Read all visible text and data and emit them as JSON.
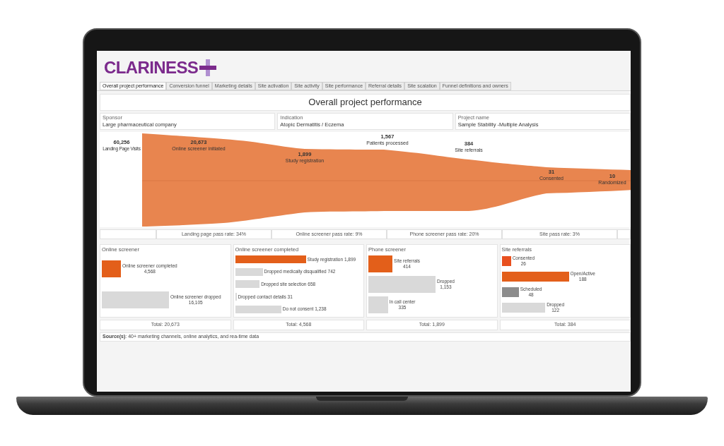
{
  "logo": {
    "text": "CLARINESS"
  },
  "tabs": [
    {
      "label": "Overall project performance",
      "selected": true
    },
    {
      "label": "Conversion funnel",
      "selected": false
    },
    {
      "label": "Marketing details",
      "selected": false
    },
    {
      "label": "Site activation",
      "selected": false
    },
    {
      "label": "Site activity",
      "selected": false
    },
    {
      "label": "Site performance",
      "selected": false
    },
    {
      "label": "Referral details",
      "selected": false
    },
    {
      "label": "Site scalation",
      "selected": false
    },
    {
      "label": "Funnel definitions and owners",
      "selected": false
    }
  ],
  "title": "Overall project performance",
  "info": [
    {
      "label": "Sponsor",
      "value": "Large pharmaceutical company"
    },
    {
      "label": "Indication",
      "value": "Atopic Dermatitis / Eczema"
    },
    {
      "label": "Project name",
      "value": "Sample Stability -Multiple Analysis"
    }
  ],
  "funnel": {
    "stages": [
      {
        "value": "60,256",
        "label": "Landing Page Visits"
      },
      {
        "value": "20,673",
        "label": "Online screener initiated"
      },
      {
        "value": "1,899",
        "label": "Study registration"
      },
      {
        "value": "1,567",
        "label": "Patients processed"
      },
      {
        "value": "384",
        "label": "Site referrals"
      },
      {
        "value": "31",
        "label": "Consented"
      },
      {
        "value": "10",
        "label": "Randomized"
      }
    ]
  },
  "pass_rates": [
    "Landing page pass rate: 34%",
    "Online screener pass rate: 9%",
    "Phone screener pass rate: 20%",
    "Site pass rate: 3%"
  ],
  "panels": [
    {
      "title": "Online screener",
      "kind": "stacked",
      "total": "Total: 20,673",
      "bars": [
        {
          "label": "Online screener completed",
          "value": "4,568",
          "color": "#e35f1a"
        },
        {
          "label": "Online screener dropped",
          "value": "16,105",
          "color": "#d9d9d9"
        }
      ]
    },
    {
      "title": "Online screener completed",
      "kind": "inline",
      "total": "Total: 4,568",
      "bars": [
        {
          "label": "Study registration",
          "value": "1,899",
          "color": "#e35f1a"
        },
        {
          "label": "Dropped medically disqualified",
          "value": "742",
          "color": "#d9d9d9"
        },
        {
          "label": "Dropped site selection",
          "value": "658",
          "color": "#d9d9d9"
        },
        {
          "label": "Dropped contact details",
          "value": "31",
          "color": "#d9d9d9"
        },
        {
          "label": "Do not consent",
          "value": "1,238",
          "color": "#d9d9d9"
        }
      ]
    },
    {
      "title": "Phone screener",
      "kind": "stacked",
      "total": "Total: 1,899",
      "bars": [
        {
          "label": "Site referrals",
          "value": "414",
          "color": "#e35f1a"
        },
        {
          "label": "Dropped",
          "value": "1,153",
          "color": "#d9d9d9"
        },
        {
          "label": "In call center",
          "value": "335",
          "color": "#d9d9d9"
        }
      ]
    },
    {
      "title": "Site referrals",
      "kind": "stacked",
      "total": "Total: 384",
      "bars": [
        {
          "label": "Consented",
          "value": "26",
          "color": "#e8501f"
        },
        {
          "label": "Open/Active",
          "value": "188",
          "color": "#e35f1a"
        },
        {
          "label": "Scheduled",
          "value": "48",
          "color": "#8c8c8c"
        },
        {
          "label": "Dropped",
          "value": "122",
          "color": "#d9d9d9"
        }
      ]
    }
  ],
  "source": "**Source(s)**: 40+ marketing channels, online analytics, and rea-time data"
}
